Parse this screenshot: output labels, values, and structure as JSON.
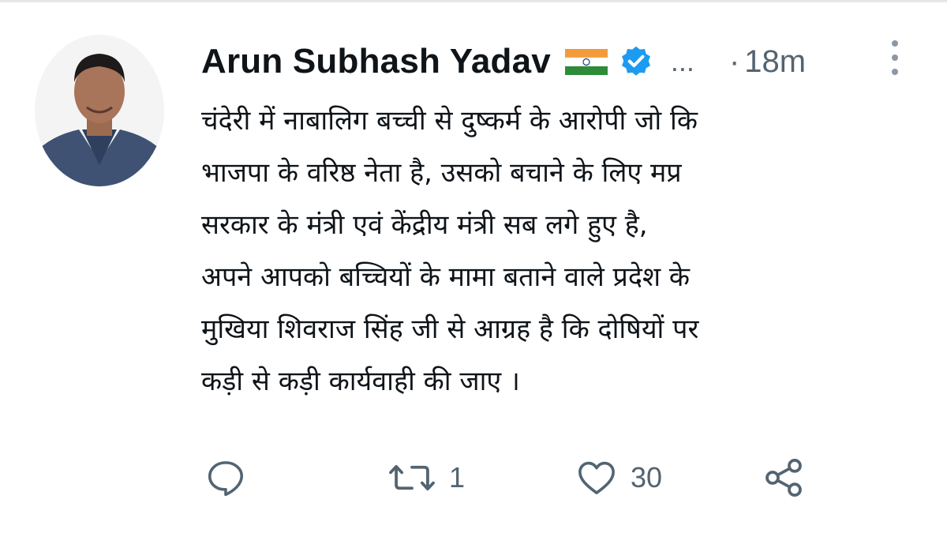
{
  "tweet": {
    "author_name": "Arun Subhash Yadav",
    "flag_emoji": "india-flag-icon",
    "verified": "verified-badge-icon",
    "ellipsis": "...",
    "dot": "·",
    "time": "18m",
    "body_lines": [
      "चंदेरी में नाबालिग बच्ची से दुष्कर्म के आरोपी जो कि",
      "भाजपा के वरिष्ठ नेता है, उसको बचाने के लिए मप्र",
      "सरकार के मंत्री एवं केंद्रीय मंत्री सब लगे हुए है,",
      "अपने आपको बच्चियों के मामा बताने वाले प्रदेश के",
      "मुखिया शिवराज सिंह जी से आग्रह है कि दोषियों पर",
      "कड़ी से कड़ी कार्यवाही की जाए ।"
    ],
    "actions": {
      "reply_icon": "reply-icon",
      "retweet_icon": "retweet-icon",
      "retweet_count": "1",
      "like_icon": "heart-icon",
      "like_count": "30",
      "share_icon": "share-icon"
    }
  },
  "colors": {
    "text": "#0f1419",
    "muted": "#536471",
    "verified_blue": "#1d9bf0"
  }
}
